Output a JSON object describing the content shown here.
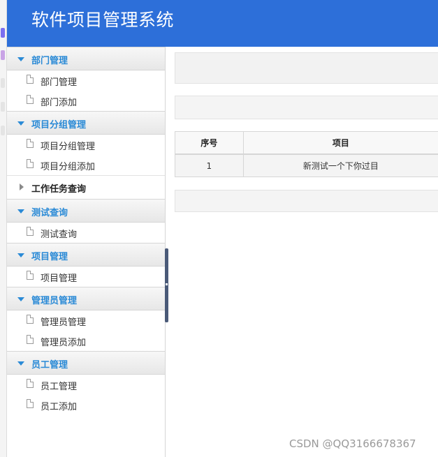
{
  "app": {
    "title": "软件项目管理系统"
  },
  "sidebar": {
    "groups": [
      {
        "label": "部门管理",
        "items": [
          {
            "label": "部门管理"
          },
          {
            "label": "部门添加"
          }
        ]
      },
      {
        "label": "项目分组管理",
        "items": [
          {
            "label": "项目分组管理"
          },
          {
            "label": "项目分组添加"
          }
        ]
      },
      {
        "label": "工作任务查询",
        "items": []
      },
      {
        "label": "测试查询",
        "items": [
          {
            "label": "测试查询"
          }
        ]
      },
      {
        "label": "项目管理",
        "items": [
          {
            "label": "项目管理"
          }
        ]
      },
      {
        "label": "管理员管理",
        "items": [
          {
            "label": "管理员管理"
          },
          {
            "label": "管理员添加"
          }
        ]
      },
      {
        "label": "员工管理",
        "items": [
          {
            "label": "员工管理"
          },
          {
            "label": "员工添加"
          }
        ]
      }
    ]
  },
  "table": {
    "headers": [
      "序号",
      "项目"
    ],
    "rows": [
      [
        "1",
        "新测试一个下你过目"
      ]
    ]
  },
  "watermark": "CSDN @QQ3166678367",
  "colors": {
    "header": "#2d6fd9",
    "accent": "#2a8ad6",
    "splitter": "#4a5a78"
  }
}
